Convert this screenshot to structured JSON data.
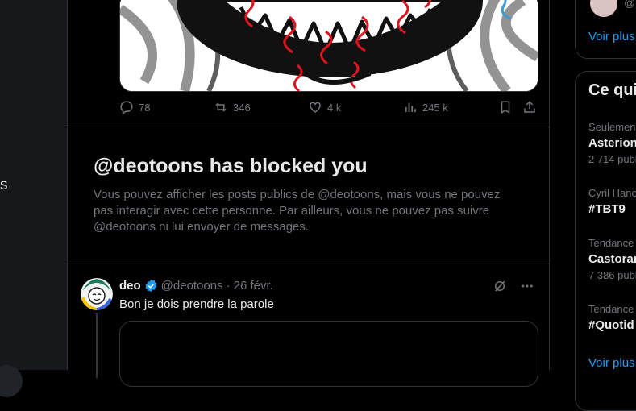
{
  "left_nav": {
    "fragment": "s"
  },
  "prev_post": {
    "actions": {
      "replies": "78",
      "reposts": "346",
      "likes": "4 k",
      "views": "245 k"
    }
  },
  "blocked": {
    "title": "@deotoons has blocked you",
    "body": "Vous pouvez afficher les posts publics de @deotoons, mais vous ne pouvez pas interagir avec cette personne. Par ailleurs, vous ne pouvez pas suivre @deotoons ni lui envoyer de messages."
  },
  "post": {
    "name": "deo",
    "handle": "@deotoons",
    "dot": "·",
    "date": "26 févr.",
    "text": "Bon je dois prendre la parole"
  },
  "right": {
    "top_handle": "@",
    "show_more_1": "Voir plus",
    "trend_heading": "Ce qui",
    "trends": [
      {
        "context": "Seulemen",
        "title": "Asterion",
        "count": "2 714 publ"
      },
      {
        "context": "Cyril Hano",
        "title": "#TBT9",
        "count": ""
      },
      {
        "context": "Tendance",
        "title": "Castoran",
        "count": "7 386 publ"
      },
      {
        "context": "Tendance",
        "title": "#Quotid",
        "count": ""
      }
    ],
    "show_more_2": "Voir plus"
  },
  "colors": {
    "accent": "#1d9bf0",
    "muted": "#71767b",
    "border": "#2f3336",
    "verified": "#1d9bf0"
  }
}
